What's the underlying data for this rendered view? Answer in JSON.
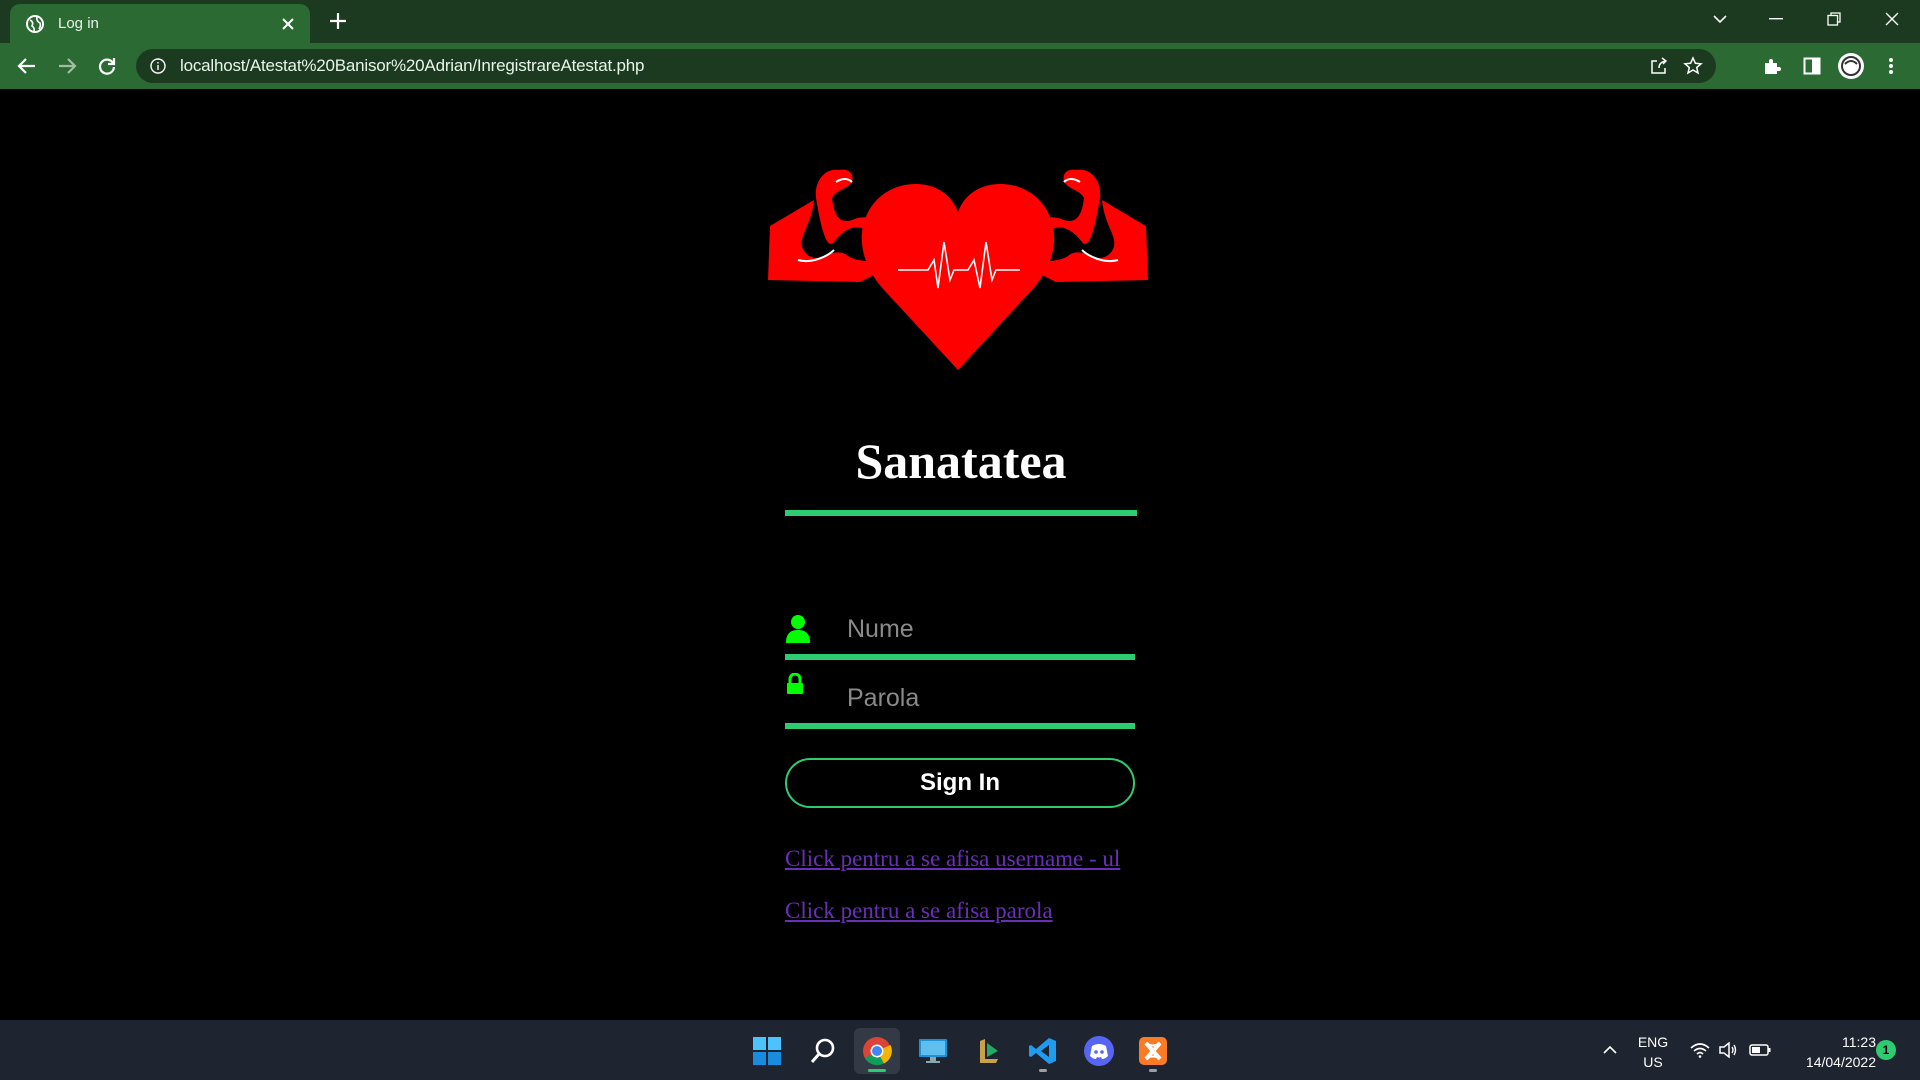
{
  "browser": {
    "tab_title": "Log in",
    "url": "localhost/Atestat%20Banisor%20Adrian/InregistrareAtestat.php"
  },
  "page": {
    "brand_title": "Sanatatea",
    "username_placeholder": "Nume",
    "password_placeholder": "Parola",
    "signin_label": "Sign In",
    "link_show_username": "Click pentru a se afisa username - ul",
    "link_show_password": "Click pentru a se afisa parola"
  },
  "taskbar": {
    "lang_top": "ENG",
    "lang_bottom": "US",
    "time": "11:23",
    "date": "14/04/2022",
    "notification_count": "1"
  },
  "colors": {
    "accent": "#2ecc71",
    "tab_active": "#2b6a33",
    "tabbar_bg": "#1b3a1f",
    "link": "#6a2fb8",
    "heart": "#ff0000",
    "icon_green": "#00ff00"
  },
  "icons": [
    "globe-icon",
    "close-icon",
    "plus-icon",
    "chevron-down-icon",
    "minimize-icon",
    "restore-icon",
    "window-close-icon",
    "back-icon",
    "forward-icon",
    "reload-icon",
    "info-icon",
    "share-icon",
    "star-icon",
    "extensions-icon",
    "sidepanel-icon",
    "profile-icon",
    "menu-icon",
    "user-icon",
    "lock-icon",
    "windows-icon",
    "search-icon",
    "chrome-icon",
    "desktop-icon",
    "app-icon",
    "vscode-icon",
    "discord-icon",
    "xampp-icon",
    "tray-chevron-icon",
    "wifi-icon",
    "volume-icon",
    "battery-icon"
  ]
}
